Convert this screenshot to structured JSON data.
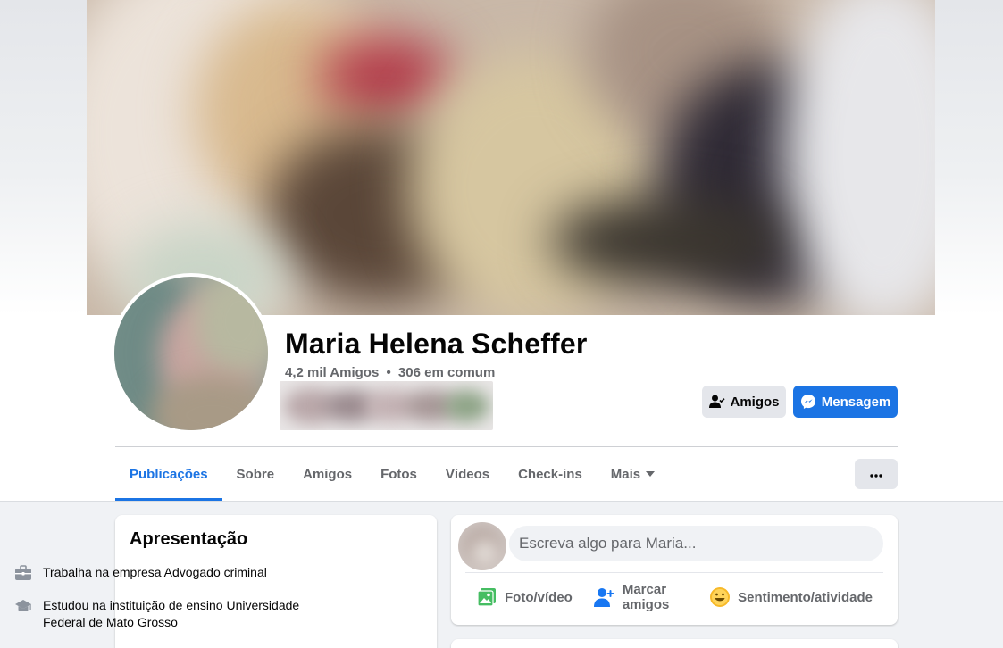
{
  "profile": {
    "name": "Maria Helena Scheffer",
    "friends_count": "4,2 mil Amigos",
    "separator": "•",
    "mutual": "306 em comum"
  },
  "actions": {
    "friends_label": "Amigos",
    "message_label": "Mensagem"
  },
  "tabs": [
    {
      "label": "Publicações",
      "active": true
    },
    {
      "label": "Sobre"
    },
    {
      "label": "Amigos"
    },
    {
      "label": "Fotos"
    },
    {
      "label": "Vídeos"
    },
    {
      "label": "Check-ins"
    },
    {
      "label": "Mais"
    }
  ],
  "more_menu": {
    "label": "···"
  },
  "intro": {
    "title": "Apresentação",
    "work": "Trabalha na empresa Advogado criminal",
    "education": "Estudou na instituição de ensino Universidade Federal de Mato Grosso"
  },
  "composer": {
    "placeholder": "Escreva algo para Maria...",
    "photo_video": "Foto/vídeo",
    "tag_friends": "Marcar amigos",
    "feeling": "Sentimento/atividade"
  },
  "icons": {
    "friends": "person-check-icon",
    "message": "messenger-icon",
    "caret": "caret-down-icon",
    "more": "ellipsis-icon",
    "work": "briefcase-icon",
    "education": "graduation-cap-icon",
    "photo": "photo-icon",
    "tag": "tag-person-icon",
    "feeling": "smiley-icon"
  },
  "colors": {
    "accent": "#1b74e4",
    "photo_green": "#45bd62",
    "tag_blue": "#1877f2",
    "feeling_yellow": "#f7b928"
  }
}
